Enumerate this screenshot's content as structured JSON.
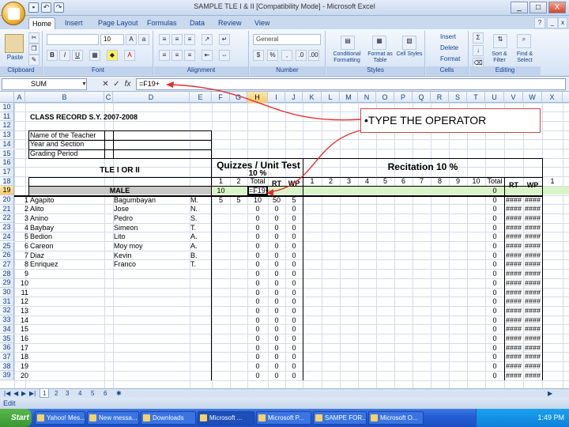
{
  "window": {
    "title": "SAMPLE TLE I & II  [Compatibility Mode] - Microsoft Excel",
    "controls": [
      "_",
      "□",
      "X"
    ]
  },
  "ribbon_tabs": [
    "Home",
    "Insert",
    "Page Layout",
    "Formulas",
    "Data",
    "Review",
    "View"
  ],
  "ribbon": {
    "clipboard": {
      "label": "Clipboard",
      "paste": "Paste"
    },
    "font": {
      "label": "Font",
      "size": "10"
    },
    "alignment": {
      "label": "Alignment"
    },
    "number": {
      "label": "Number",
      "format": "General"
    },
    "styles": {
      "label": "Styles",
      "conditional": "Conditional Formatting",
      "format_table": "Format as Table",
      "cell_styles": "Cell Styles"
    },
    "cells": {
      "label": "Cells",
      "insert": "Insert",
      "delete": "Delete",
      "format": "Format"
    },
    "editing": {
      "label": "Editing",
      "sort": "Sort & Filter",
      "find": "Find & Select"
    }
  },
  "formula_bar": {
    "name_box": "SUM",
    "formula": "=F19+"
  },
  "columns": [
    "A",
    "B",
    "C",
    "D",
    "E",
    "F",
    "G",
    "H",
    "I",
    "J",
    "K",
    "L",
    "M",
    "N",
    "O",
    "P",
    "Q",
    "R",
    "S",
    "T",
    "U",
    "V",
    "W",
    "X"
  ],
  "selected_column": "H",
  "row_numbers": [
    "10",
    "11",
    "12",
    "13",
    "14",
    "15",
    "16",
    "17",
    "18",
    "19",
    "20",
    "21",
    "22",
    "23",
    "24",
    "25",
    "26",
    "27",
    "28",
    "29",
    "30",
    "31",
    "32",
    "33",
    "34",
    "35",
    "36",
    "37",
    "38",
    "39"
  ],
  "selected_row": "19",
  "sheet": {
    "title": "CLASS RECORD S.Y. 2007-2008",
    "info_labels": [
      "Name    of the Teacher",
      "Year and Section",
      "Grading Period"
    ],
    "subject": "TLE I OR II",
    "quizzes_header": "Quizzes / Unit Test",
    "quizzes_pct": "10 %",
    "recitation_header": "Recitation  10 %",
    "quiz_cols": [
      "1",
      "2",
      "Total",
      "RT",
      "WP"
    ],
    "rec_cols": [
      "1",
      "2",
      "3",
      "4",
      "5",
      "6",
      "7",
      "8",
      "9",
      "10"
    ],
    "rec_total": "Total",
    "rec_rt": "RT",
    "rec_wp": "WP",
    "last_col_head": "1",
    "male_label": "MALE",
    "row19": {
      "f": "10",
      "h": "=F19+",
      "u": "0"
    },
    "row20": {
      "f": "5",
      "g": "5",
      "h": "10",
      "i": "50",
      "j": "5"
    },
    "students": [
      {
        "num": "1",
        "last": "Agapito",
        "first": "Bagumbayan",
        "mi": "M."
      },
      {
        "num": "2",
        "last": "Alito",
        "first": "Jose",
        "mi": "N."
      },
      {
        "num": "3",
        "last": "Anino",
        "first": "Pedro",
        "mi": "S."
      },
      {
        "num": "4",
        "last": "Baybay",
        "first": "Simeon",
        "mi": "T."
      },
      {
        "num": "5",
        "last": "Bedion",
        "first": "Lito",
        "mi": "A."
      },
      {
        "num": "6",
        "last": "Careon",
        "first": "Moy moy",
        "mi": "A."
      },
      {
        "num": "7",
        "last": "Diaz",
        "first": "Kevin",
        "mi": "B."
      },
      {
        "num": "8",
        "last": "Enriquez",
        "first": "Franco",
        "mi": "T."
      },
      {
        "num": "9",
        "last": "",
        "first": "",
        "mi": ""
      },
      {
        "num": "10",
        "last": "",
        "first": "",
        "mi": ""
      },
      {
        "num": "11",
        "last": "",
        "first": "",
        "mi": ""
      },
      {
        "num": "12",
        "last": "",
        "first": "",
        "mi": ""
      },
      {
        "num": "13",
        "last": "",
        "first": "",
        "mi": ""
      },
      {
        "num": "14",
        "last": "",
        "first": "",
        "mi": ""
      },
      {
        "num": "15",
        "last": "",
        "first": "",
        "mi": ""
      },
      {
        "num": "16",
        "last": "",
        "first": "",
        "mi": ""
      },
      {
        "num": "17",
        "last": "",
        "first": "",
        "mi": ""
      },
      {
        "num": "18",
        "last": "",
        "first": "",
        "mi": ""
      },
      {
        "num": "19",
        "last": "",
        "first": "",
        "mi": ""
      },
      {
        "num": "20",
        "last": "",
        "first": "",
        "mi": ""
      }
    ],
    "zero": "0",
    "hash": "####"
  },
  "callout": "•TYPE THE OPERATOR",
  "sheet_tabs": [
    "1",
    "2",
    "3",
    "4",
    "5",
    "6"
  ],
  "status": "Edit",
  "taskbar": {
    "start": "Start",
    "items": [
      "Yahoo! Mes...",
      "New messa...",
      "Downloads",
      "Microsoft ...",
      "Microsoft P...",
      "SAMPE FOR...",
      "Microsoft O..."
    ],
    "active_index": 3,
    "clock": "1:49 PM"
  }
}
